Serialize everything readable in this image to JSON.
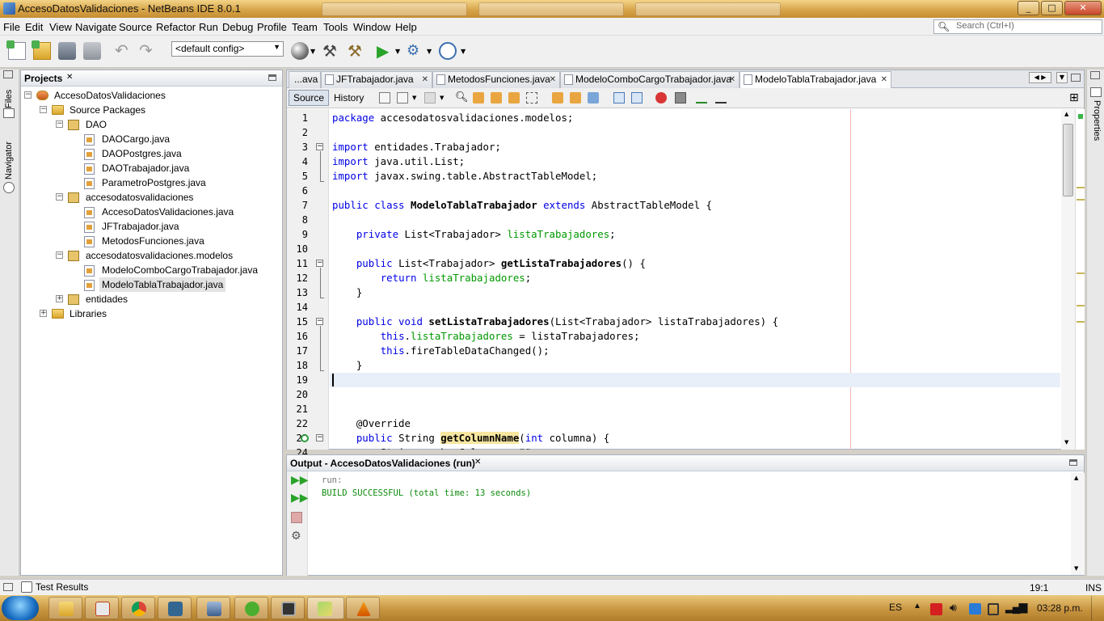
{
  "window": {
    "title": "AccesoDatosValidaciones - NetBeans IDE 8.0.1",
    "controls": [
      "_",
      "□",
      "✕"
    ]
  },
  "menu": [
    "File",
    "Edit",
    "View",
    "Navigate",
    "Source",
    "Refactor",
    "Run",
    "Debug",
    "Profile",
    "Team",
    "Tools",
    "Window",
    "Help"
  ],
  "search": {
    "placeholder": "Search (Ctrl+I)"
  },
  "toolbar": {
    "config": "<default config>"
  },
  "left_strip": {
    "files": "Files",
    "navigator": "Navigator"
  },
  "right_strip": {
    "properties": "Properties"
  },
  "projects": {
    "title": "Projects",
    "tree": [
      {
        "label": "AccesoDatosValidaciones",
        "level": 0,
        "kind": "project",
        "toggle": "-"
      },
      {
        "label": "Source Packages",
        "level": 1,
        "kind": "folder",
        "toggle": "-"
      },
      {
        "label": "DAO",
        "level": 2,
        "kind": "package",
        "toggle": "-"
      },
      {
        "label": "DAOCargo.java",
        "level": 3,
        "kind": "file"
      },
      {
        "label": "DAOPostgres.java",
        "level": 3,
        "kind": "file"
      },
      {
        "label": "DAOTrabajador.java",
        "level": 3,
        "kind": "file"
      },
      {
        "label": "ParametroPostgres.java",
        "level": 3,
        "kind": "file"
      },
      {
        "label": "accesodatosvalidaciones",
        "level": 2,
        "kind": "package",
        "toggle": "-"
      },
      {
        "label": "AccesoDatosValidaciones.java",
        "level": 3,
        "kind": "file"
      },
      {
        "label": "JFTrabajador.java",
        "level": 3,
        "kind": "file"
      },
      {
        "label": "MetodosFunciones.java",
        "level": 3,
        "kind": "file"
      },
      {
        "label": "accesodatosvalidaciones.modelos",
        "level": 2,
        "kind": "package",
        "toggle": "-"
      },
      {
        "label": "ModeloComboCargoTrabajador.java",
        "level": 3,
        "kind": "file"
      },
      {
        "label": "ModeloTablaTrabajador.java",
        "level": 3,
        "kind": "file",
        "selected": true
      },
      {
        "label": "entidades",
        "level": 2,
        "kind": "package",
        "toggle": "+"
      },
      {
        "label": "Libraries",
        "level": 1,
        "kind": "folder",
        "toggle": "+"
      }
    ]
  },
  "editor": {
    "tabs": [
      {
        "label": "...ava",
        "active": false
      },
      {
        "label": "JFTrabajador.java",
        "active": false
      },
      {
        "label": "MetodosFunciones.java",
        "active": false
      },
      {
        "label": "ModeloComboCargoTrabajador.java",
        "active": false
      },
      {
        "label": "ModeloTablaTrabajador.java",
        "active": true
      }
    ],
    "source_btn": "Source",
    "history_btn": "History",
    "lines": [
      {
        "n": "1",
        "fold": "",
        "html": "<span class='kw'>package</span> accesodatosvalidaciones.modelos;"
      },
      {
        "n": "2",
        "fold": "",
        "html": ""
      },
      {
        "n": "3",
        "fold": "-",
        "html": "<span class='kw'>import</span> entidades.Trabajador;"
      },
      {
        "n": "4",
        "fold": "",
        "html": "<span class='kw'>import</span> java.util.List;"
      },
      {
        "n": "5",
        "fold": "",
        "html": "<span class='kw'>import</span> javax.swing.table.AbstractTableModel;"
      },
      {
        "n": "6",
        "fold": "",
        "html": ""
      },
      {
        "n": "7",
        "fold": "",
        "html": "<span class='kw'>public class</span> <span class='mtd'>ModeloTablaTrabajador</span> <span class='kw'>extends</span> AbstractTableModel {"
      },
      {
        "n": "8",
        "fold": "",
        "html": ""
      },
      {
        "n": "9",
        "fold": "",
        "html": "    <span class='kw'>private</span> List&lt;Trabajador&gt; <span class='fld'>listaTrabajadores</span>;"
      },
      {
        "n": "10",
        "fold": "",
        "html": ""
      },
      {
        "n": "11",
        "fold": "-",
        "html": "    <span class='kw'>public</span> List&lt;Trabajador&gt; <span class='mtd'>getListaTrabajadores</span>() {"
      },
      {
        "n": "12",
        "fold": "",
        "html": "        <span class='kw'>return</span> <span class='fld'>listaTrabajadores</span>;"
      },
      {
        "n": "13",
        "fold": "",
        "html": "    }"
      },
      {
        "n": "14",
        "fold": "",
        "html": ""
      },
      {
        "n": "15",
        "fold": "-",
        "html": "    <span class='kw'>public void</span> <span class='mtd'>setListaTrabajadores</span>(List&lt;Trabajador&gt; listaTrabajadores) {"
      },
      {
        "n": "16",
        "fold": "",
        "html": "        <span class='kw'>this</span>.<span class='fld'>listaTrabajadores</span> = listaTrabajadores;"
      },
      {
        "n": "17",
        "fold": "",
        "html": "        <span class='kw'>this</span>.fireTableDataChanged();"
      },
      {
        "n": "18",
        "fold": "",
        "html": "    }"
      },
      {
        "n": "19",
        "fold": "",
        "html": ""
      },
      {
        "n": "20",
        "fold": "",
        "html": ""
      },
      {
        "n": "21",
        "fold": "",
        "html": ""
      },
      {
        "n": "22",
        "fold": "",
        "html": "    @Override"
      },
      {
        "n": "23",
        "fold": "-",
        "html": "    <span class='kw'>public</span> String <span class='mtd' style='background:#f7e6a0'>getColumnName</span>(<span class='kw'>int</span> columna) {"
      },
      {
        "n": "24",
        "fold": "",
        "html": "        String nombreColumna = \"\";"
      }
    ],
    "cursor_line": 19
  },
  "output": {
    "title": "Output - AccesoDatosValidaciones (run)",
    "lines": [
      "run:",
      "BUILD SUCCESSFUL (total time: 13 seconds)"
    ]
  },
  "status": {
    "test_results": "Test Results",
    "position": "19:1",
    "mode": "INS"
  },
  "taskbar": {
    "language": "ES",
    "clock": "03:28 p.m."
  }
}
